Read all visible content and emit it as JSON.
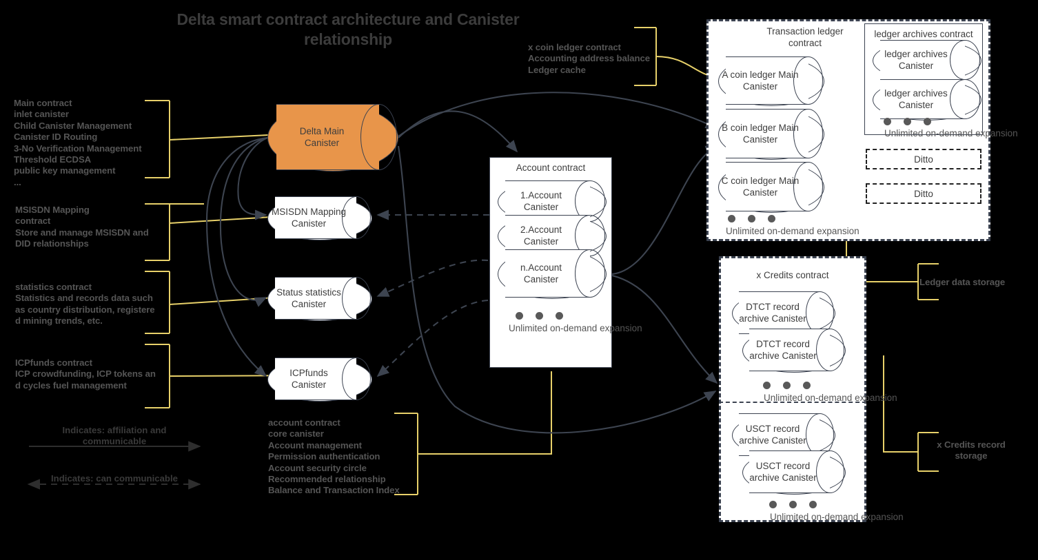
{
  "title": "Delta smart contract architecture and\nCanister relationship",
  "colors": {
    "background": "#000000",
    "accent_orange": "#E8954A",
    "leader_yellow": "#E8D16A",
    "stroke_dark": "#3b4250",
    "text_gray": "#555555"
  },
  "annotations": {
    "main_contract": "Main contract\ninlet canister\nChild Canister Management\nCanister ID Routing\n3-No Verification Management\nThreshold ECDSA\npublic key management\n...",
    "msisdn": "MSISDN Mapping\ncontract\nStore and manage MSISDN and\nDID relationships",
    "statistics": "statistics contract\nStatistics and records data such\nas country distribution, registere\nd mining trends, etc.",
    "icpfunds": "ICPfunds contract\nICP crowdfunding, ICP tokens an\nd cycles fuel management",
    "account_contract_detail": "account contract\ncore canister\nAccount management\nPermission authentication\nAccount security circle\nRecommended relationship\nBalance and Transaction Index",
    "x_coin_ledger": "x coin ledger contract\nAccounting address balance\nLedger cache",
    "ledger_data_storage": "Ledger data storage",
    "x_credits_record_storage": "x Credits record\nstorage"
  },
  "legend": {
    "solid_label": "Indicates: affiliation and\ncommunicable",
    "dashed_label": "Indicates: can communicable"
  },
  "main_column": {
    "delta_main": "Delta Main\nCanister",
    "msisdn_canister": "MSISDN Mapping\nCanister",
    "status_canister": "Status statistics\nCanister",
    "icpfunds_canister": "ICPfunds\nCanister"
  },
  "account_contract": {
    "title": "Account contract",
    "canisters": [
      "1.Account\nCanister",
      "2.Account\nCanister",
      "n.Account\nCanister"
    ],
    "expansion_caption": "Unlimited on-demand expansion"
  },
  "transaction_ledger": {
    "title": "Transaction ledger\ncontract",
    "main_canisters": [
      "A coin ledger Main\nCanister",
      "B coin ledger Main\nCanister",
      "C coin ledger Main\nCanister"
    ],
    "expansion_caption": "Unlimited on-demand expansion",
    "archives": {
      "title": "ledger archives contract",
      "canisters": [
        "ledger archives\nCanister",
        "ledger archives\nCanister"
      ],
      "expansion_caption": "Unlimited on-demand expansion"
    },
    "ditto_boxes": [
      "Ditto",
      "Ditto"
    ]
  },
  "x_credits": {
    "title": "x Credits contract",
    "dtct_canisters": [
      "DTCT record\narchive Canister",
      "DTCT record\narchive Canister"
    ],
    "dtct_expansion_caption": "Unlimited on-demand expansion",
    "usct_canisters": [
      "USCT record\narchive Canister",
      "USCT record\narchive Canister"
    ],
    "usct_expansion_caption": "Unlimited on-demand expansion"
  }
}
